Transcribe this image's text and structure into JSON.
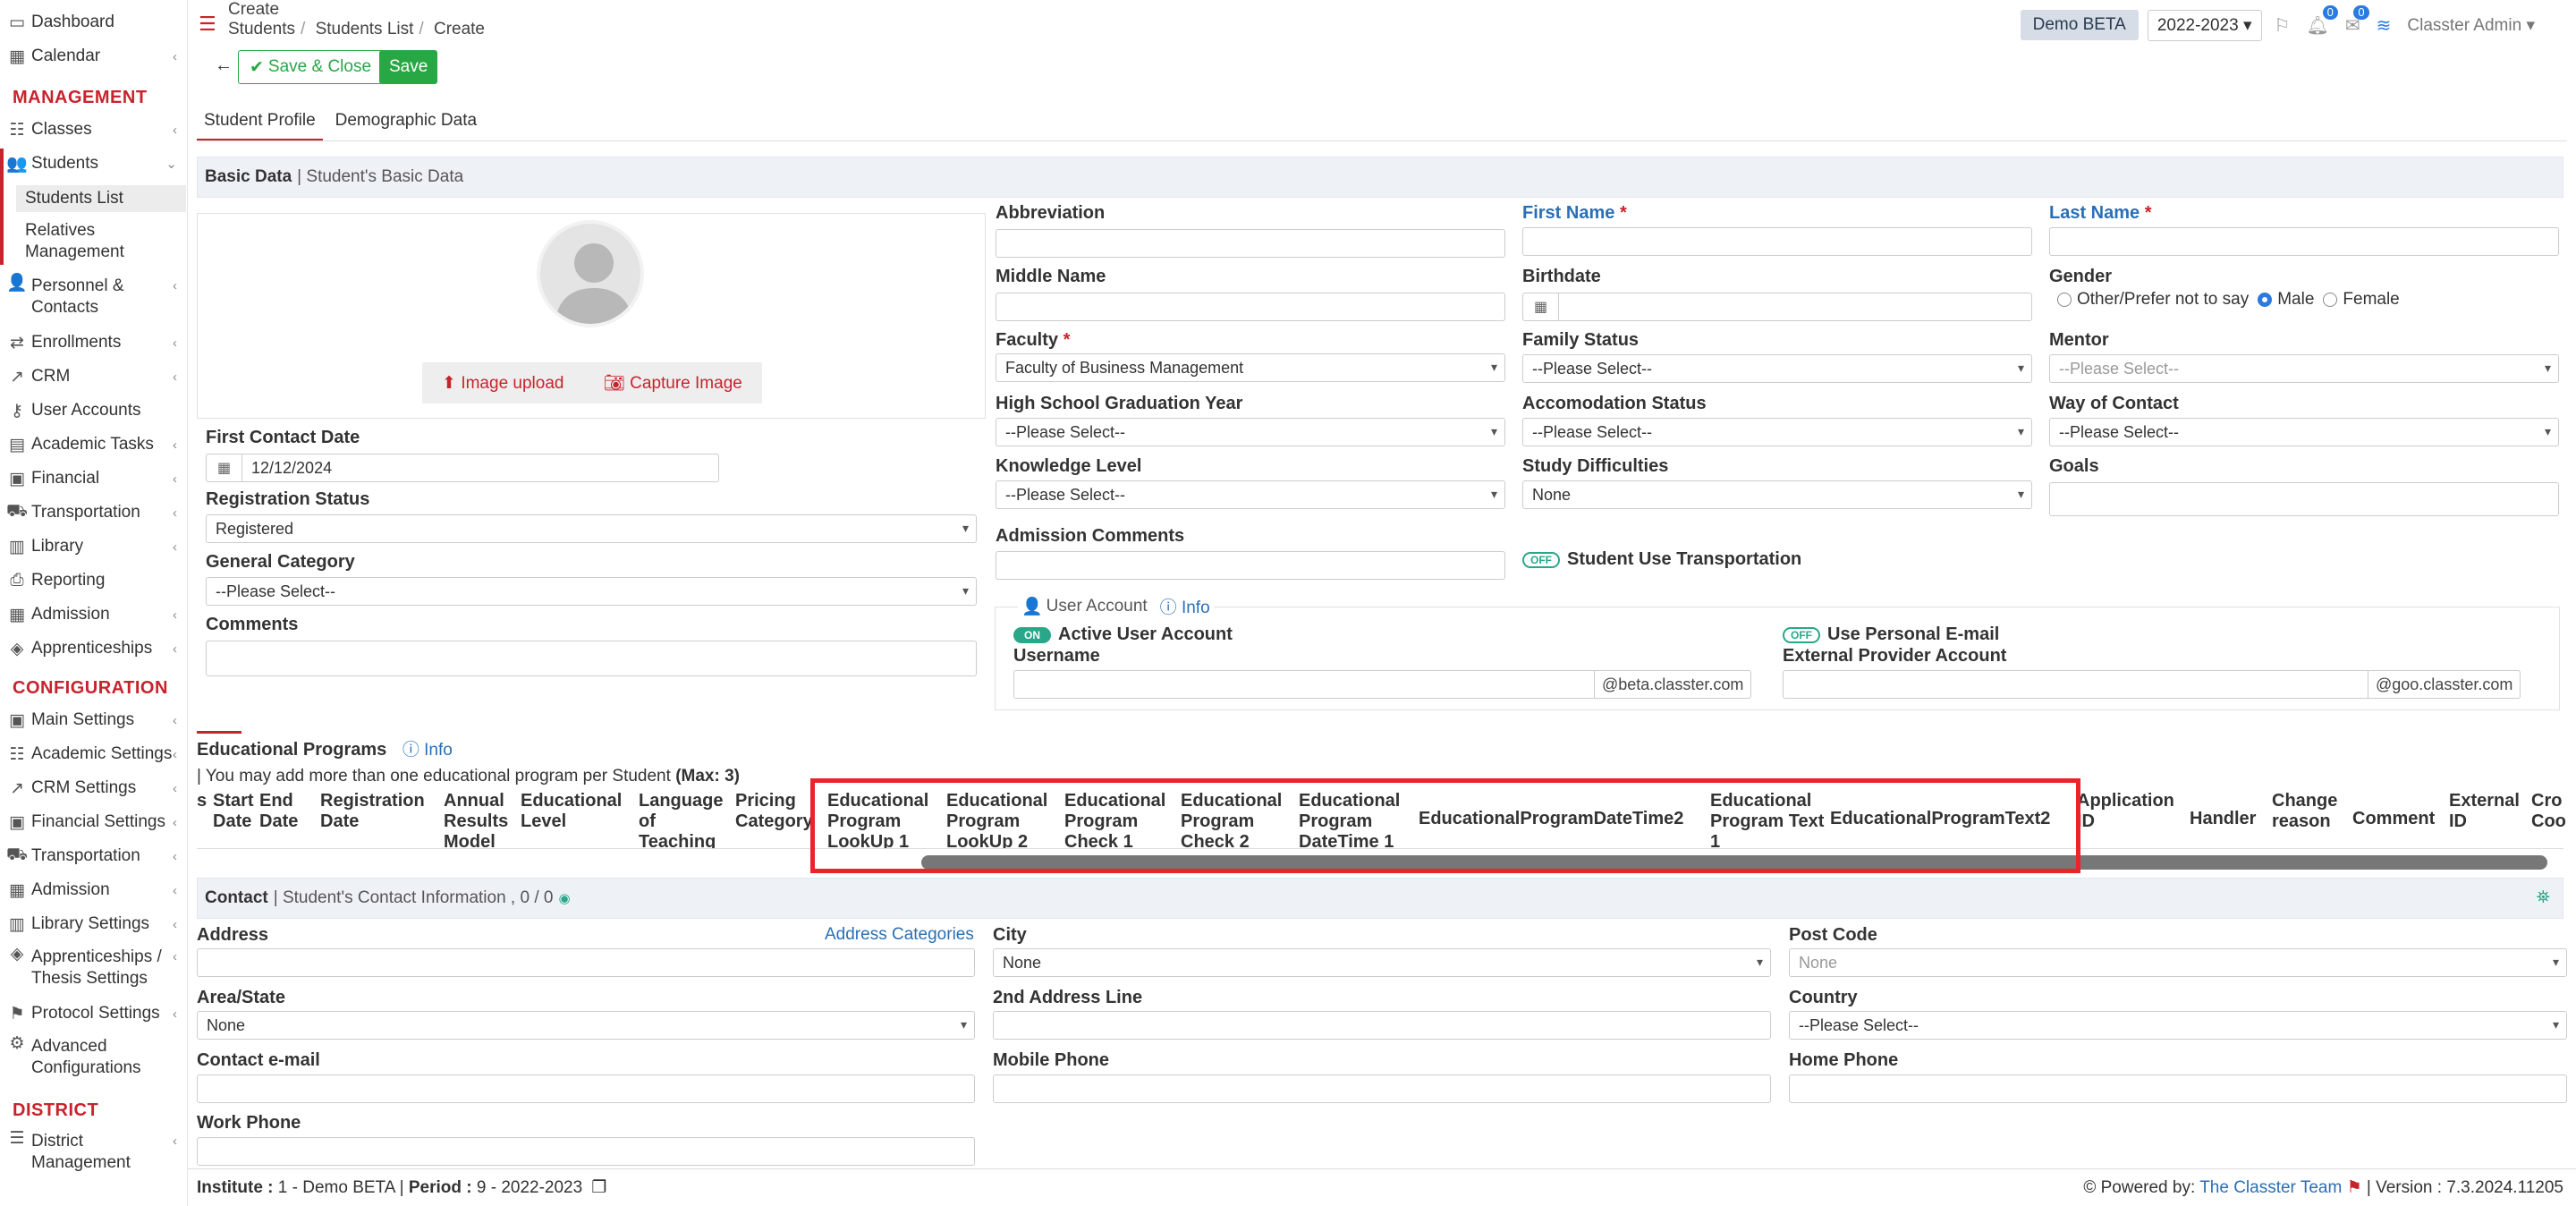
{
  "sidebar": {
    "dashboard": "Dashboard",
    "calendar": "Calendar",
    "management": "MANAGEMENT",
    "classes": "Classes",
    "students": "Students",
    "students_list": "Students List",
    "relatives": "Relatives Management",
    "personnel": "Personnel & Contacts",
    "enrollments": "Enrollments",
    "crm": "CRM",
    "user_accounts": "User Accounts",
    "academic_tasks": "Academic Tasks",
    "financial": "Financial",
    "transportation": "Transportation",
    "library": "Library",
    "reporting": "Reporting",
    "admission": "Admission",
    "apprenticeships": "Apprenticeships",
    "configuration": "CONFIGURATION",
    "main_settings": "Main Settings",
    "academic_settings": "Academic Settings",
    "crm_settings": "CRM Settings",
    "financial_settings": "Financial Settings",
    "transportation2": "Transportation",
    "admission2": "Admission",
    "library_settings": "Library Settings",
    "apprenticeships_settings": "Apprenticeships / Thesis Settings",
    "protocol_settings": "Protocol Settings",
    "advanced": "Advanced Configurations",
    "district": "DISTRICT",
    "district_mgmt": "District Management"
  },
  "header": {
    "title": "Create",
    "bc1": "Students",
    "bc2": "Students List",
    "bc3": "Create",
    "demo": "Demo BETA",
    "year": "2022-2023",
    "notif_count": "0",
    "msg_count": "0",
    "user": "Classter Admin"
  },
  "toolbar": {
    "save_close": "Save & Close",
    "save": "Save"
  },
  "tabs": {
    "profile": "Student Profile",
    "demographic": "Demographic Data"
  },
  "basic": {
    "title": "Basic Data",
    "subtitle": "Student's Basic Data",
    "image_upload": "Image upload",
    "capture_image": "Capture Image",
    "first_contact_date_label": "First Contact Date",
    "first_contact_date": "12/12/2024",
    "registration_status_label": "Registration Status",
    "registration_status": "Registered",
    "general_category_label": "General Category",
    "general_category": "--Please Select--",
    "comments_label": "Comments",
    "abbreviation": "Abbreviation",
    "first_name": "First Name",
    "last_name": "Last Name",
    "middle_name": "Middle Name",
    "birthdate": "Birthdate",
    "gender": "Gender",
    "gender_other": "Other/Prefer not to say",
    "gender_male": "Male",
    "gender_female": "Female",
    "faculty_label": "Faculty",
    "faculty": "Faculty of Business Management",
    "family_status_label": "Family Status",
    "family_status": "--Please Select--",
    "mentor_label": "Mentor",
    "mentor": "--Please Select--",
    "hs_grad_label": "High School Graduation Year",
    "hs_grad": "--Please Select--",
    "accom_label": "Accomodation Status",
    "accom": "--Please Select--",
    "way_label": "Way of Contact",
    "way": "--Please Select--",
    "knowledge_label": "Knowledge Level",
    "knowledge": "--Please Select--",
    "difficulties_label": "Study Difficulties",
    "difficulties": "None",
    "goals_label": "Goals",
    "admission_comments_label": "Admission Comments",
    "transport_toggle": "OFF",
    "transport_label": "Student Use Transportation",
    "user_account": "User Account",
    "info": "Info",
    "active_toggle": "ON",
    "active_label": "Active User Account",
    "personal_toggle": "OFF",
    "personal_label": "Use Personal E-mail",
    "username_label": "Username",
    "username_domain": "@beta.classter.com",
    "external_label": "External Provider Account",
    "external_domain": "@goo.classter.com"
  },
  "educational_programs": {
    "title": "Educational Programs",
    "info": "Info",
    "note": "| You may add more than one educational program per Student",
    "max": "(Max: 3)",
    "columns": [
      "s",
      "Start Date",
      "End Date",
      "Registration Date",
      "Annual Results Model",
      "Educational Level",
      "Language of Teaching",
      "Pricing Category",
      "Educational Program LookUp 1",
      "Educational Program LookUp 2",
      "Educational Program Check 1",
      "Educational Program Check 2",
      "Educational Program DateTime 1",
      "EducationalProgramDateTime2",
      "Educational Program Text 1",
      "EducationalProgramText2",
      "Application ID",
      "Handler",
      "Change reason",
      "Comment",
      "External ID",
      "Cro Coo"
    ]
  },
  "contact": {
    "title": "Contact",
    "subtitle": "| Student's Contact Information , 0 / 0",
    "address_label": "Address",
    "address_categories": "Address Categories",
    "city_label": "City",
    "city": "None",
    "postcode_label": "Post Code",
    "postcode": "None",
    "area_label": "Area/State",
    "area": "None",
    "address2_label": "2nd Address Line",
    "country_label": "Country",
    "country": "--Please Select--",
    "email_label": "Contact e-mail",
    "mobile_label": "Mobile Phone",
    "home_label": "Home Phone",
    "work_label": "Work Phone"
  },
  "footer": {
    "institute_label": "Institute :",
    "institute": "1 - Demo BETA |",
    "period_label": "Period :",
    "period": "9 - 2022-2023",
    "powered": "Powered by:",
    "team": "The Classter Team",
    "version": "| Version : 7.3.2024.11205"
  },
  "colors": {
    "accent": "#c8232c",
    "success": "#28a745",
    "link": "#2a6fb5",
    "highlight": "#e8242c"
  }
}
